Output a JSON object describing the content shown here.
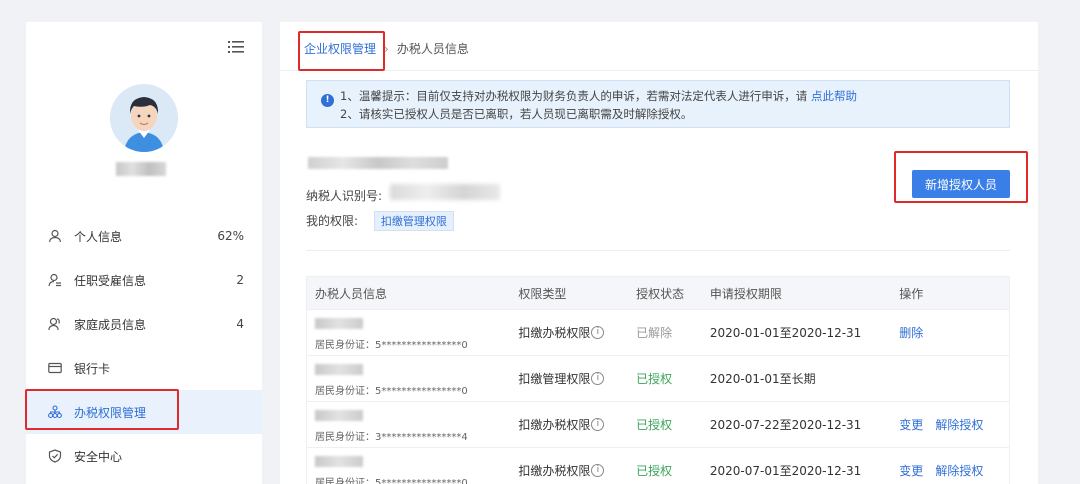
{
  "sidebar": {
    "items": [
      {
        "label": "个人信息",
        "count": "62%",
        "icon": "user-icon"
      },
      {
        "label": "任职受雇信息",
        "count": "2",
        "icon": "user-list-icon"
      },
      {
        "label": "家庭成员信息",
        "count": "4",
        "icon": "family-icon"
      },
      {
        "label": "银行卡",
        "count": "",
        "icon": "card-icon"
      },
      {
        "label": "办税权限管理",
        "count": "",
        "icon": "org-icon"
      },
      {
        "label": "安全中心",
        "count": "",
        "icon": "shield-icon"
      }
    ]
  },
  "breadcrumb": {
    "parent": "企业权限管理",
    "separator": "›",
    "current": "办税人员信息"
  },
  "notice": {
    "line1": "1、温馨提示：目前仅支持对办税权限为财务负责人的申诉，若需对法定代表人进行申诉，请",
    "link": "点此帮助",
    "line2": "2、请核实已授权人员是否已离职，若人员现已离职需及时解除授权。"
  },
  "company": {
    "taxpayer_id_label": "纳税人识别号:",
    "my_permission_label": "我的权限:",
    "permission_tag": "扣缴管理权限"
  },
  "add_button": "新增授权人员",
  "table": {
    "headers": [
      "办税人员信息",
      "权限类型",
      "授权状态",
      "申请授权期限",
      "操作"
    ],
    "rows": [
      {
        "id": "居民身份证：5****************0",
        "type": "扣缴办税权限",
        "has_info": true,
        "status": "已解除",
        "status_kind": "off",
        "period": "2020-01-01至2020-12-31",
        "actions": [
          "删除"
        ]
      },
      {
        "id": "居民身份证：5****************0",
        "type": "扣缴管理权限",
        "has_info": true,
        "status": "已授权",
        "status_kind": "on",
        "period": "2020-01-01至长期",
        "actions": []
      },
      {
        "id": "居民身份证：3****************4",
        "type": "扣缴办税权限",
        "has_info": true,
        "status": "已授权",
        "status_kind": "on",
        "period": "2020-07-22至2020-12-31",
        "actions": [
          "变更",
          "解除授权"
        ]
      },
      {
        "id": "居民身份证：5****************0",
        "type": "扣缴办税权限",
        "has_info": true,
        "status": "已授权",
        "status_kind": "on",
        "period": "2020-07-01至2020-12-31",
        "actions": [
          "变更",
          "解除授权"
        ]
      }
    ]
  },
  "colors": {
    "accent": "#2f6fd6",
    "button": "#3a7ee8",
    "authorized": "#3aa55a",
    "highlight_box": "#e0292b"
  }
}
